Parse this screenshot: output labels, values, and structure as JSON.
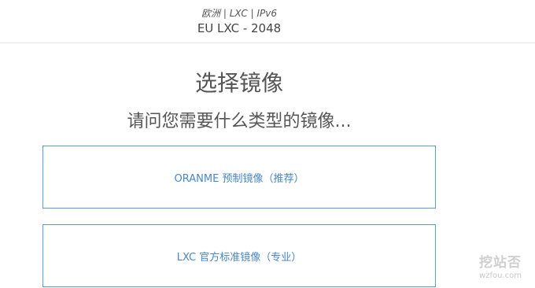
{
  "header": {
    "subtitle": "欧洲 | LXC | IPv6",
    "plan_name": "EU LXC - 2048"
  },
  "main": {
    "title": "选择镜像",
    "question": "请问您需要什么类型的镜像..."
  },
  "options": [
    {
      "label": "ORANME 预制镜像（推荐）"
    },
    {
      "label": "LXC 官方标准镜像（专业）"
    }
  ],
  "watermark": {
    "logo": "挖站否",
    "url": "wzfou.com"
  }
}
